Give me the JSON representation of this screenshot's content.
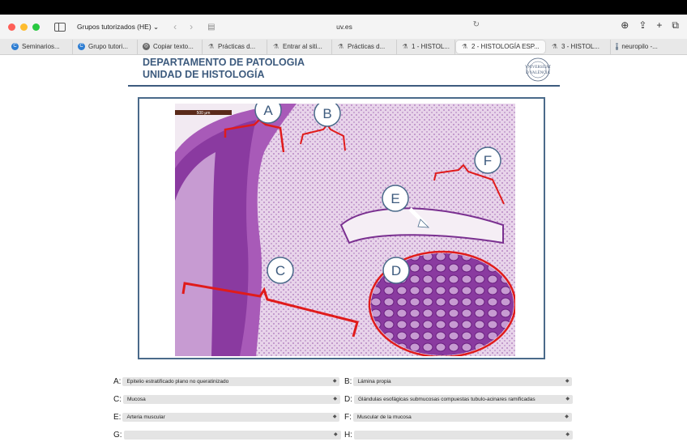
{
  "browser": {
    "group_name": "Grupos tutorizados (HE) ⌄",
    "url": "uv.es",
    "tabs": [
      {
        "label": "Seminarios...",
        "icon": "c-icon"
      },
      {
        "label": "Grupo tutori...",
        "icon": "c-icon"
      },
      {
        "label": "Copiar texto...",
        "icon": "globe-icon"
      },
      {
        "label": "Prácticas d...",
        "icon": "flask-icon"
      },
      {
        "label": "Entrar al siti...",
        "icon": "flask-icon"
      },
      {
        "label": "Prácticas d...",
        "icon": "flask-icon"
      },
      {
        "label": "1 - HISTOL...",
        "icon": "flask-icon"
      },
      {
        "label": "2 - HISTOLOGÍA ESP...",
        "icon": "flask-icon",
        "active": true
      },
      {
        "label": "3 - HISTOL...",
        "icon": "flask-icon"
      },
      {
        "label": "neuropilo -...",
        "icon": "n-icon"
      }
    ]
  },
  "header": {
    "line1": "DEPARTAMENTO DE PATOLOGIA",
    "line2": "UNIDAD DE HISTOLOGÍA",
    "logo_text": "UNIVERSITAT DE VALÈNCIA"
  },
  "figure": {
    "scale_bar": "500 μm",
    "markers": [
      "A",
      "B",
      "C",
      "D",
      "E",
      "F"
    ]
  },
  "answers": [
    {
      "letter": "A:",
      "value": "Epitelio estratificado plano no queratinizado"
    },
    {
      "letter": "B:",
      "value": "Lámina propia"
    },
    {
      "letter": "C:",
      "value": "Mucosa"
    },
    {
      "letter": "D:",
      "value": "Glándulas esofágicas submucosas compuestas tubulo-acinares ramificadas"
    },
    {
      "letter": "E:",
      "value": "Arteria muscular"
    },
    {
      "letter": "F:",
      "value": "Muscular de la mucosa"
    },
    {
      "letter": "G:",
      "value": ""
    },
    {
      "letter": "H:",
      "value": ""
    }
  ],
  "colors": {
    "header_blue": "#3d5b7e",
    "annotation_red": "#e01b1b",
    "tissue_purple": "#8a3aa0"
  }
}
